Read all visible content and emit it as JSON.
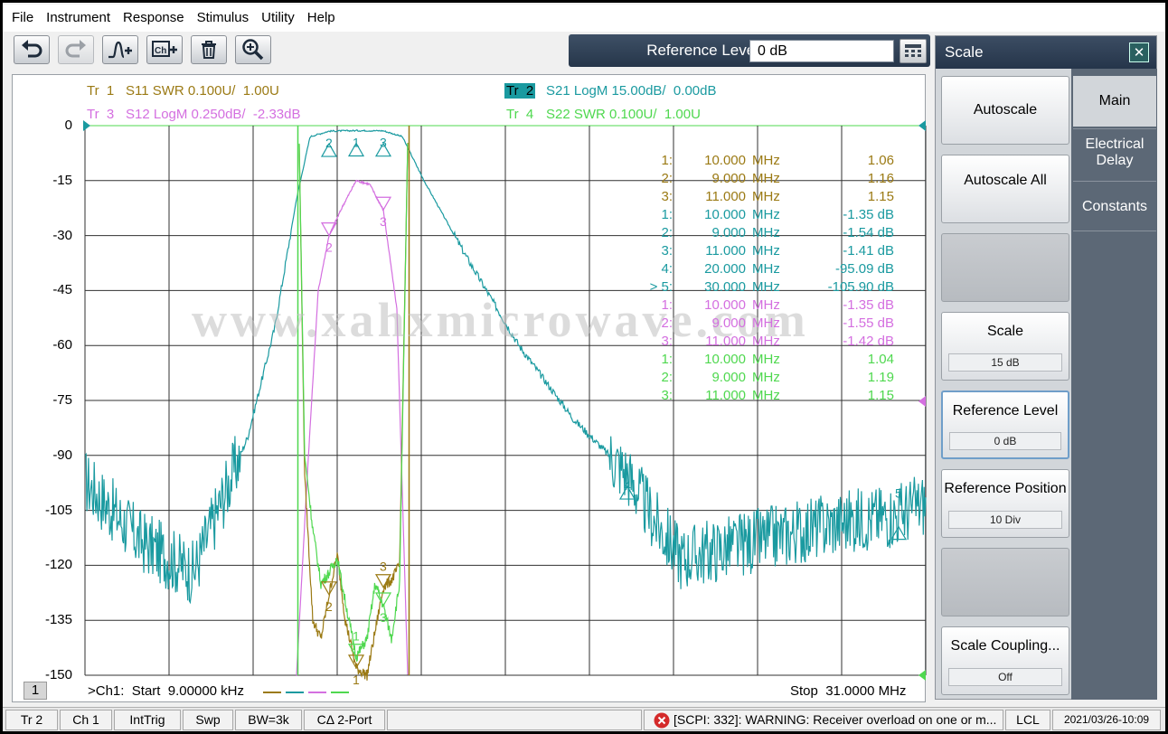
{
  "menu": [
    "File",
    "Instrument",
    "Response",
    "Stimulus",
    "Utility",
    "Help"
  ],
  "toolbar": {
    "icons": [
      "undo-icon",
      "redo-icon",
      "add-trace-icon",
      "add-channel-icon",
      "delete-icon",
      "zoom-icon"
    ]
  },
  "entry": {
    "label": "Reference Level",
    "value": "0 dB"
  },
  "traces": {
    "tr1": {
      "id": "Tr  1",
      "text": "S11 SWR 0.100U/  1.00U",
      "color": "#9b7a14"
    },
    "tr2": {
      "id": "Tr  2",
      "text": "S21 LogM 15.00dB/  0.00dB",
      "color": "#1a9aa0"
    },
    "tr3": {
      "id": "Tr  3",
      "text": "S12 LogM 0.250dB/  -2.33dB",
      "color": "#d46fe0"
    },
    "tr4": {
      "id": "Tr  4",
      "text": "S22 SWR 0.100U/  1.00U",
      "color": "#4fd84f"
    }
  },
  "y_ticks": [
    "0",
    "-15",
    "-30",
    "-45",
    "-60",
    "-75",
    "-90",
    "-105",
    "-120",
    "-135",
    "-150"
  ],
  "markers": [
    {
      "num": "1:",
      "freq": "10.000",
      "unit": "MHz",
      "val": "1.06",
      "color": "#9b7a14"
    },
    {
      "num": "2:",
      "freq": "9.000",
      "unit": "MHz",
      "val": "1.16",
      "color": "#9b7a14"
    },
    {
      "num": "3:",
      "freq": "11.000",
      "unit": "MHz",
      "val": "1.15",
      "color": "#9b7a14"
    },
    {
      "num": "1:",
      "freq": "10.000",
      "unit": "MHz",
      "val": "-1.35 dB",
      "color": "#1a9aa0"
    },
    {
      "num": "2:",
      "freq": "9.000",
      "unit": "MHz",
      "val": "-1.54 dB",
      "color": "#1a9aa0"
    },
    {
      "num": "3:",
      "freq": "11.000",
      "unit": "MHz",
      "val": "-1.41 dB",
      "color": "#1a9aa0"
    },
    {
      "num": "4:",
      "freq": "20.000",
      "unit": "MHz",
      "val": "-95.09 dB",
      "color": "#1a9aa0"
    },
    {
      "num": "> 5:",
      "freq": "30.000",
      "unit": "MHz",
      "val": "-105.90 dB",
      "color": "#1a9aa0"
    },
    {
      "num": "1:",
      "freq": "10.000",
      "unit": "MHz",
      "val": "-1.35 dB",
      "color": "#d46fe0"
    },
    {
      "num": "2:",
      "freq": "9.000",
      "unit": "MHz",
      "val": "-1.55 dB",
      "color": "#d46fe0"
    },
    {
      "num": "3:",
      "freq": "11.000",
      "unit": "MHz",
      "val": "-1.42 dB",
      "color": "#d46fe0"
    },
    {
      "num": "1:",
      "freq": "10.000",
      "unit": "MHz",
      "val": "1.04",
      "color": "#4fd84f"
    },
    {
      "num": "2:",
      "freq": "9.000",
      "unit": "MHz",
      "val": "1.19",
      "color": "#4fd84f"
    },
    {
      "num": "3:",
      "freq": "11.000",
      "unit": "MHz",
      "val": "1.15",
      "color": "#4fd84f"
    }
  ],
  "chart_marker_tags": {
    "tr2": [
      "2",
      "1",
      "3",
      "4",
      "5"
    ],
    "tr3": [
      "2",
      "3"
    ],
    "tr1": [
      "2",
      "1",
      "3"
    ],
    "tr4": [
      "1",
      "3"
    ]
  },
  "watermark": "www.xahxmicrowave.com",
  "bottom": {
    "channel": "1",
    "start": ">Ch1:  Start  9.00000 kHz",
    "stop": "Stop  31.0000 MHz"
  },
  "panel": {
    "title": "Scale",
    "softkeys": [
      {
        "label": "Autoscale",
        "sub": ""
      },
      {
        "label": "Autoscale All",
        "sub": ""
      },
      {
        "label": "",
        "sub": ""
      },
      {
        "label": "Scale",
        "sub": "15 dB"
      },
      {
        "label": "Reference Level",
        "sub": "0 dB"
      },
      {
        "label": "Reference Position",
        "sub": "10 Div"
      },
      {
        "label": "",
        "sub": ""
      },
      {
        "label": "Scale Coupling...",
        "sub": "Off"
      }
    ],
    "tabs": [
      "Main",
      "Electrical Delay",
      "Constants"
    ]
  },
  "statusbar": {
    "tr": "Tr 2",
    "ch": "Ch 1",
    "trig": "IntTrig",
    "swp": "Swp",
    "bw": "BW=3k",
    "cal": "CΔ 2-Port",
    "message": "[SCPI: 332]: WARNING: Receiver overload on one or m...",
    "lcl": "LCL",
    "datetime": "2021/03/26-10:09"
  },
  "chart_data": {
    "type": "line",
    "x_start": "9.00000 kHz",
    "x_stop": "31.0000 MHz",
    "ylim": [
      -150,
      0
    ],
    "y_ticks": [
      0,
      -15,
      -30,
      -45,
      -60,
      -75,
      -90,
      -105,
      -120,
      -135,
      -150
    ],
    "grid": true,
    "series": [
      {
        "name": "S21 LogM",
        "color": "#1a9aa0",
        "x_mhz": [
          0.01,
          2,
          4,
          5,
          6,
          7,
          7.8,
          8.3,
          9,
          10,
          11,
          11.7,
          12.5,
          14,
          16,
          18,
          20,
          21,
          22,
          25,
          28,
          30,
          31
        ],
        "y_db": [
          -97,
          -113,
          -122,
          -103,
          -85,
          -55,
          -20,
          -3,
          -1.5,
          -1.35,
          -1.4,
          -3,
          -15,
          -35,
          -60,
          -80,
          -95,
          -108,
          -118,
          -113,
          -108,
          -106,
          -103
        ]
      },
      {
        "name": "S12 LogM",
        "color": "#d46fe0",
        "x_mhz": [
          7.8,
          8.2,
          8.6,
          9,
          9.5,
          10,
          10.5,
          11,
          11.5,
          11.9
        ],
        "y_db": [
          -150,
          -95,
          -45,
          -30,
          -22,
          -15,
          -16,
          -23,
          -50,
          -150
        ]
      },
      {
        "name": "S11 SWR",
        "color": "#9b7a14",
        "x_mhz": [
          7.9,
          8.1,
          8.4,
          8.7,
          9,
          9.3,
          9.6,
          10,
          10.4,
          10.7,
          11,
          11.3,
          11.6,
          11.9
        ],
        "y_db": [
          -5,
          -95,
          -135,
          -140,
          -128,
          -117,
          -135,
          -148,
          -150,
          -138,
          -126,
          -124,
          -120,
          -5
        ]
      },
      {
        "name": "S22 SWR",
        "color": "#4fd84f",
        "x_mhz": [
          7.9,
          8.1,
          8.4,
          8.7,
          9,
          9.3,
          9.6,
          10,
          10.4,
          10.7,
          11,
          11.3,
          11.6,
          11.9
        ],
        "y_db": [
          -5,
          -90,
          -110,
          -125,
          -122,
          -118,
          -130,
          -145,
          -140,
          -125,
          -131,
          -140,
          -125,
          -5
        ]
      }
    ]
  }
}
